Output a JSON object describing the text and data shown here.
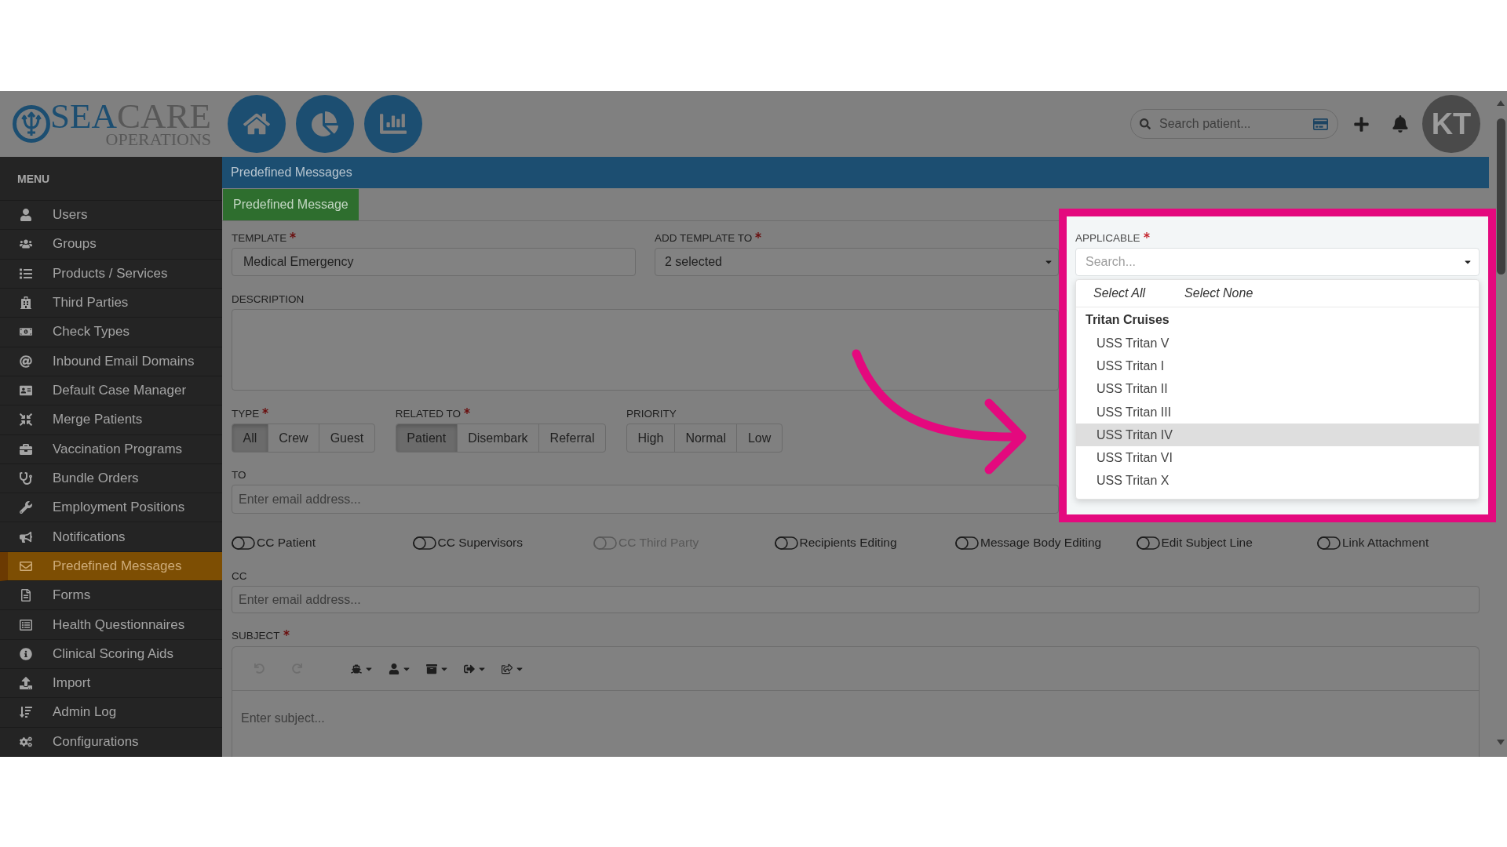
{
  "logo": {
    "wordmark": [
      "SEA",
      "CARE"
    ],
    "tagline": "OPERATIONS"
  },
  "header": {
    "search": {
      "placeholder": "Search patient..."
    },
    "avatar": {
      "initials": "KT"
    }
  },
  "sidebar": {
    "heading": "MENU",
    "items": [
      {
        "label": "Users",
        "selected": false
      },
      {
        "label": "Groups",
        "selected": false
      },
      {
        "label": "Products / Services",
        "selected": false
      },
      {
        "label": "Third Parties",
        "selected": false
      },
      {
        "label": "Check Types",
        "selected": false
      },
      {
        "label": "Inbound Email Domains",
        "selected": false
      },
      {
        "label": "Default Case Manager",
        "selected": false
      },
      {
        "label": "Merge Patients",
        "selected": false
      },
      {
        "label": "Vaccination Programs",
        "selected": false
      },
      {
        "label": "Bundle Orders",
        "selected": false
      },
      {
        "label": "Employment Positions",
        "selected": false
      },
      {
        "label": "Notifications",
        "selected": false
      },
      {
        "label": "Predefined Messages",
        "selected": true
      },
      {
        "label": "Forms",
        "selected": false
      },
      {
        "label": "Health Questionnaires",
        "selected": false
      },
      {
        "label": "Clinical Scoring Aids",
        "selected": false
      },
      {
        "label": "Import",
        "selected": false
      },
      {
        "label": "Admin Log",
        "selected": false
      },
      {
        "label": "Configurations",
        "selected": false
      }
    ]
  },
  "page": {
    "title": "Predefined Messages",
    "tabs": [
      {
        "label": "Predefined Message",
        "selected": true
      }
    ]
  },
  "form": {
    "template": {
      "label": "TEMPLATE",
      "required": true,
      "value": "Medical Emergency"
    },
    "add_template_to": {
      "label": "ADD TEMPLATE TO",
      "required": true,
      "value": "2 selected"
    },
    "applicable": {
      "label": "APPLICABLE",
      "required": true,
      "placeholder": "Search...",
      "menu": {
        "actions": [
          "Select All",
          "Select None"
        ],
        "groups": [
          {
            "name": "Tritan Cruises",
            "options": [
              {
                "label": "USS Tritan V",
                "highlighted": false
              },
              {
                "label": "USS Tritan I",
                "highlighted": false
              },
              {
                "label": "USS Tritan II",
                "highlighted": false
              },
              {
                "label": "USS Tritan III",
                "highlighted": false
              },
              {
                "label": "USS Tritan IV",
                "highlighted": true
              },
              {
                "label": "USS Tritan VI",
                "highlighted": false
              },
              {
                "label": "USS Tritan X",
                "highlighted": false
              }
            ]
          }
        ]
      }
    },
    "description": {
      "label": "DESCRIPTION"
    },
    "type": {
      "label": "TYPE",
      "required": true,
      "options": [
        {
          "label": "All",
          "selected": true
        },
        {
          "label": "Crew",
          "selected": false
        },
        {
          "label": "Guest",
          "selected": false
        }
      ]
    },
    "related_to": {
      "label": "RELATED TO",
      "required": true,
      "options": [
        {
          "label": "Patient",
          "selected": true
        },
        {
          "label": "Disembark",
          "selected": false
        },
        {
          "label": "Referral",
          "selected": false
        }
      ]
    },
    "priority": {
      "label": "PRIORITY",
      "options": [
        {
          "label": "High",
          "selected": false
        },
        {
          "label": "Normal",
          "selected": false
        },
        {
          "label": "Low",
          "selected": false
        }
      ]
    },
    "to": {
      "label": "TO",
      "placeholder": "Enter email address..."
    },
    "toggles": [
      {
        "label": "CC Patient",
        "on": false,
        "disabled": false
      },
      {
        "label": "CC Supervisors",
        "on": false,
        "disabled": false
      },
      {
        "label": "CC Third Party",
        "on": false,
        "disabled": true
      },
      {
        "label": "Recipients Editing",
        "on": false,
        "disabled": false
      },
      {
        "label": "Message Body Editing",
        "on": false,
        "disabled": false
      },
      {
        "label": "Edit Subject Line",
        "on": false,
        "disabled": false
      },
      {
        "label": "Link Attachment",
        "on": false,
        "disabled": false
      }
    ],
    "cc": {
      "label": "CC",
      "placeholder": "Enter email address..."
    },
    "subject": {
      "label": "SUBJECT",
      "required": true,
      "placeholder": "Enter subject...",
      "toolbar": {
        "undo": {
          "disabled": true
        },
        "redo": {
          "disabled": true
        }
      }
    }
  }
}
